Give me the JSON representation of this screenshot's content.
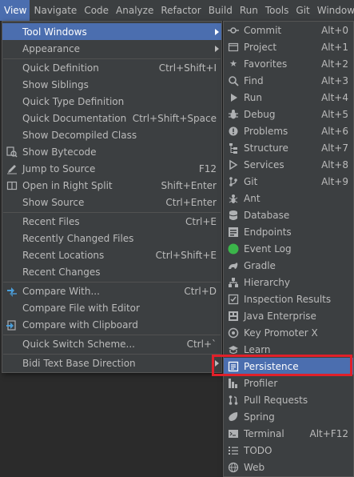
{
  "menubar": {
    "items": [
      "View",
      "Navigate",
      "Code",
      "Analyze",
      "Refactor",
      "Build",
      "Run",
      "Tools",
      "Git",
      "Window"
    ]
  },
  "view_menu": {
    "items": [
      {
        "label": "Tool Windows",
        "shortcut": "",
        "icon": "none",
        "submenu": true
      },
      {
        "label": "Appearance",
        "shortcut": "",
        "icon": "none",
        "submenu": true
      },
      {
        "label": "Quick Definition",
        "shortcut": "Ctrl+Shift+I",
        "icon": "none"
      },
      {
        "label": "Show Siblings",
        "shortcut": "",
        "icon": "none"
      },
      {
        "label": "Quick Type Definition",
        "shortcut": "",
        "icon": "none"
      },
      {
        "label": "Quick Documentation",
        "shortcut": "Ctrl+Shift+Space",
        "icon": "none"
      },
      {
        "label": "Show Decompiled Class",
        "shortcut": "",
        "icon": "none"
      },
      {
        "label": "Show Bytecode",
        "shortcut": "",
        "icon": "bytecode-icon"
      },
      {
        "label": "Jump to Source",
        "shortcut": "F12",
        "icon": "pencil-icon"
      },
      {
        "label": "Open in Right Split",
        "shortcut": "Shift+Enter",
        "icon": "split-icon"
      },
      {
        "label": "Show Source",
        "shortcut": "Ctrl+Enter",
        "icon": "none"
      },
      {
        "label": "Recent Files",
        "shortcut": "Ctrl+E",
        "icon": "none"
      },
      {
        "label": "Recently Changed Files",
        "shortcut": "",
        "icon": "none"
      },
      {
        "label": "Recent Locations",
        "shortcut": "Ctrl+Shift+E",
        "icon": "none"
      },
      {
        "label": "Recent Changes",
        "shortcut": "",
        "icon": "none"
      },
      {
        "label": "Compare With...",
        "shortcut": "Ctrl+D",
        "icon": "compare-icon"
      },
      {
        "label": "Compare File with Editor",
        "shortcut": "",
        "icon": "none"
      },
      {
        "label": "Compare with Clipboard",
        "shortcut": "",
        "icon": "clipboard-compare-icon"
      },
      {
        "label": "Quick Switch Scheme...",
        "shortcut": "Ctrl+`",
        "icon": "none"
      },
      {
        "label": "Bidi Text Base Direction",
        "shortcut": "",
        "icon": "none",
        "submenu": true
      }
    ]
  },
  "tool_windows": {
    "items": [
      {
        "label": "Commit",
        "shortcut": "Alt+0",
        "icon": "commit-icon"
      },
      {
        "label": "Project",
        "shortcut": "Alt+1",
        "icon": "project-icon"
      },
      {
        "label": "Favorites",
        "shortcut": "Alt+2",
        "icon": "star-icon"
      },
      {
        "label": "Find",
        "shortcut": "Alt+3",
        "icon": "search-icon"
      },
      {
        "label": "Run",
        "shortcut": "Alt+4",
        "icon": "run-icon"
      },
      {
        "label": "Debug",
        "shortcut": "Alt+5",
        "icon": "bug-icon"
      },
      {
        "label": "Problems",
        "shortcut": "Alt+6",
        "icon": "problems-icon"
      },
      {
        "label": "Structure",
        "shortcut": "Alt+7",
        "icon": "structure-icon"
      },
      {
        "label": "Services",
        "shortcut": "Alt+8",
        "icon": "services-icon"
      },
      {
        "label": "Git",
        "shortcut": "Alt+9",
        "icon": "git-icon"
      },
      {
        "label": "Ant",
        "shortcut": "",
        "icon": "ant-icon"
      },
      {
        "label": "Database",
        "shortcut": "",
        "icon": "database-icon"
      },
      {
        "label": "Endpoints",
        "shortcut": "",
        "icon": "endpoints-icon"
      },
      {
        "label": "Event Log",
        "shortcut": "",
        "icon": "event-log-icon"
      },
      {
        "label": "Gradle",
        "shortcut": "",
        "icon": "gradle-icon"
      },
      {
        "label": "Hierarchy",
        "shortcut": "",
        "icon": "hierarchy-icon"
      },
      {
        "label": "Inspection Results",
        "shortcut": "",
        "icon": "inspection-icon"
      },
      {
        "label": "Java Enterprise",
        "shortcut": "",
        "icon": "java-enterprise-icon"
      },
      {
        "label": "Key Promoter X",
        "shortcut": "",
        "icon": "key-promoter-icon"
      },
      {
        "label": "Learn",
        "shortcut": "",
        "icon": "learn-icon"
      },
      {
        "label": "Persistence",
        "shortcut": "",
        "icon": "persistence-icon"
      },
      {
        "label": "Profiler",
        "shortcut": "",
        "icon": "profiler-icon"
      },
      {
        "label": "Pull Requests",
        "shortcut": "",
        "icon": "pull-requests-icon"
      },
      {
        "label": "Spring",
        "shortcut": "",
        "icon": "spring-icon"
      },
      {
        "label": "Terminal",
        "shortcut": "Alt+F12",
        "icon": "terminal-icon"
      },
      {
        "label": "TODO",
        "shortcut": "",
        "icon": "todo-icon"
      },
      {
        "label": "Web",
        "shortcut": "",
        "icon": "web-icon"
      }
    ]
  },
  "colors": {
    "menu_bg": "#3c3f41",
    "selection": "#4b6eaf",
    "highlight_box": "#e0202a",
    "event_log_dot": "#3bb54a"
  }
}
